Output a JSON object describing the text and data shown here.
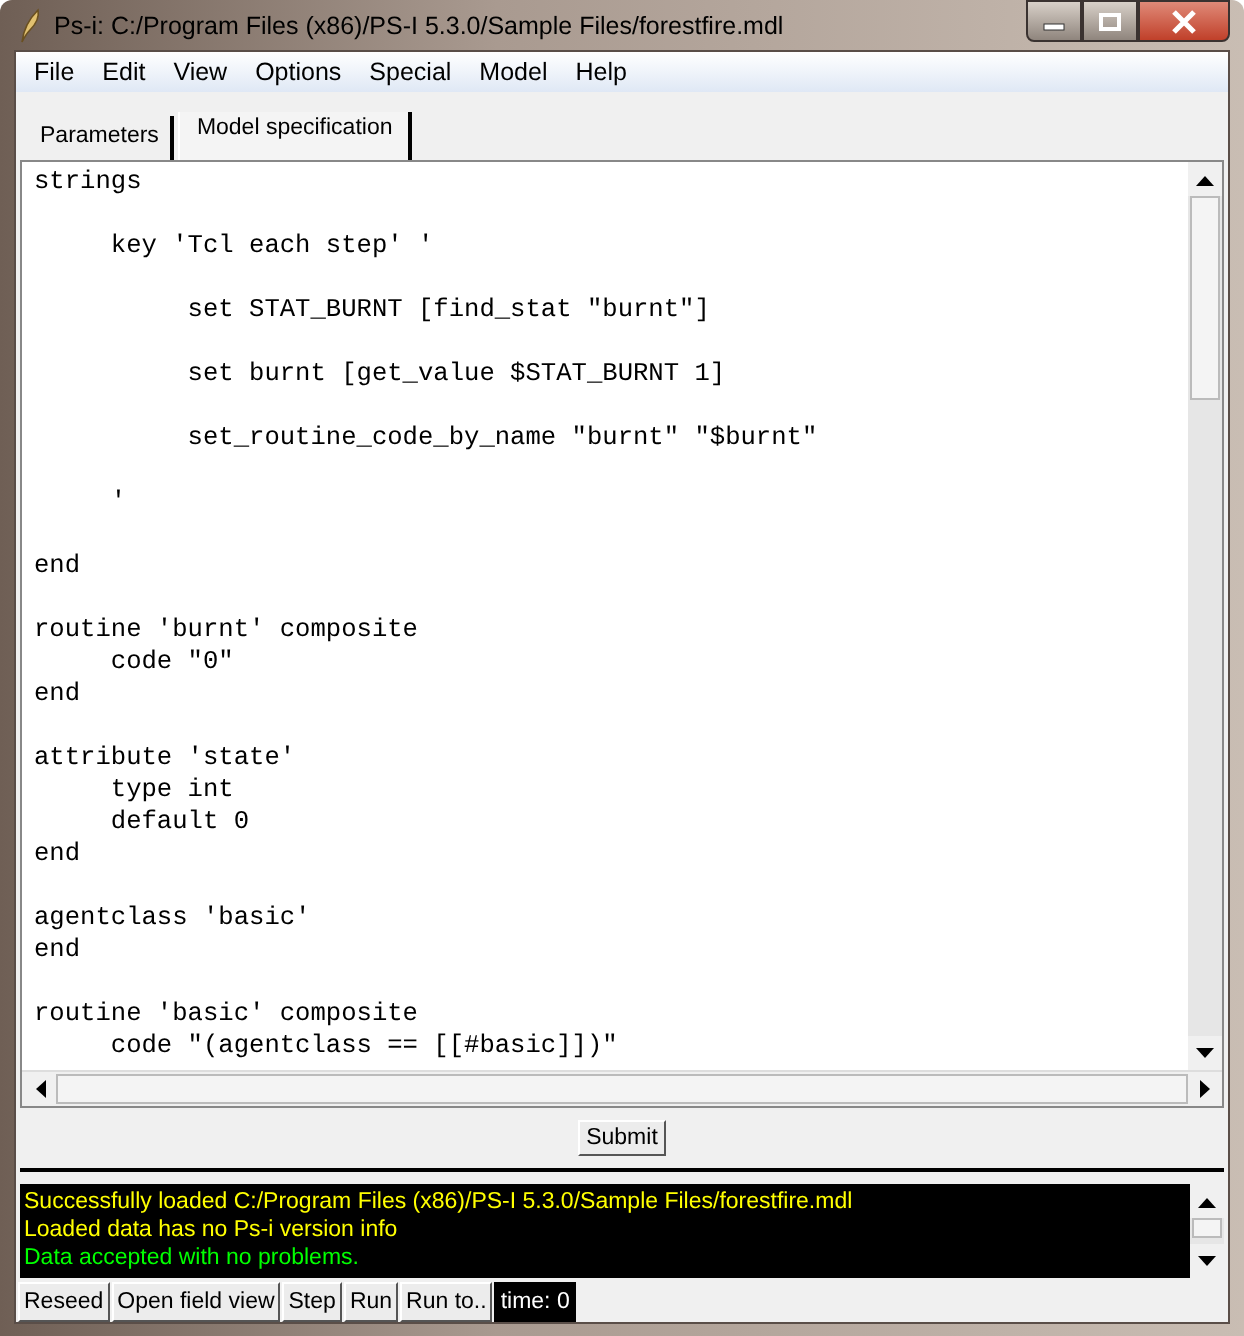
{
  "window": {
    "title": "Ps-i: C:/Program Files (x86)/PS-I 5.3.0/Sample Files/forestfire.mdl"
  },
  "menu": [
    "File",
    "Edit",
    "View",
    "Options",
    "Special",
    "Model",
    "Help"
  ],
  "tabs": [
    {
      "label": "Parameters",
      "selected": false
    },
    {
      "label": "Model specification",
      "selected": true
    }
  ],
  "editor": {
    "code": "strings\n\n     key 'Tcl each step' '\n\n          set STAT_BURNT [find_stat \"burnt\"]\n\n          set burnt [get_value $STAT_BURNT 1]\n\n          set_routine_code_by_name \"burnt\" \"$burnt\"\n\n     '\n\nend\n\nroutine 'burnt' composite\n     code \"0\"\nend\n\nattribute 'state'\n     type int\n     default 0\nend\n\nagentclass 'basic'\nend\n\nroutine 'basic' composite\n     code \"(agentclass == [[#basic]])\""
  },
  "submit_button": "Submit",
  "log": [
    {
      "text": "Successfully loaded C:/Program Files (x86)/PS-I 5.3.0/Sample Files/forestfire.mdl",
      "color": "#ffff00"
    },
    {
      "text": "Loaded data has no Ps-i version info",
      "color": "#ffff00"
    },
    {
      "text": "Data accepted with no problems.",
      "color": "#00ff00"
    }
  ],
  "toolbar": [
    "Reseed",
    "Open field view",
    "Step",
    "Run",
    "Run to.."
  ],
  "time": "time: 0"
}
